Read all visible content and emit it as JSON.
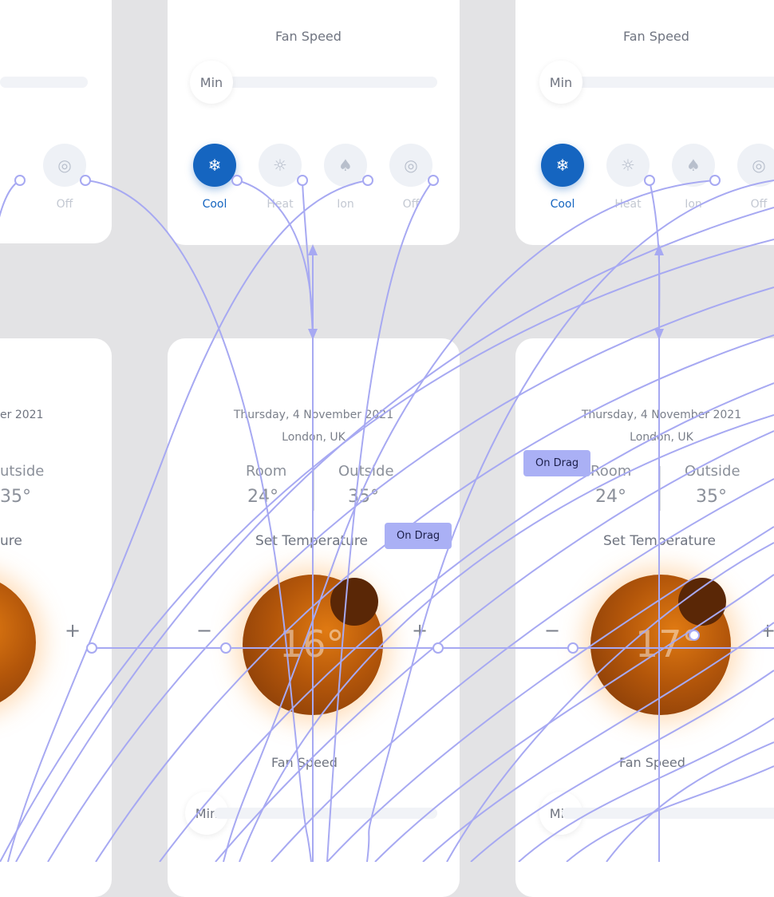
{
  "fan_speed_label": "Fan Speed",
  "min_label": "Min",
  "modes": [
    {
      "label": "Cool",
      "icon": "snowflake-icon",
      "glyph": "❄"
    },
    {
      "label": "Heat",
      "icon": "sun-icon",
      "glyph": "☼"
    },
    {
      "label": "Ion",
      "icon": "tree-icon",
      "glyph": "♠"
    },
    {
      "label": "Off",
      "icon": "power-icon",
      "glyph": "◎"
    }
  ],
  "partial_left": {
    "date": "er 2021",
    "outside": "utside",
    "outside_value": "35°",
    "set_temp": "ure"
  },
  "middle": {
    "date": "Thursday, 4 November 2021",
    "location": "London, UK",
    "room_label": "Room",
    "room_value": "24°",
    "outside_label": "Outside",
    "outside_value": "35°",
    "set_temp": "Set Temperature",
    "temp": "16°"
  },
  "right": {
    "date": "Thursday, 4 November 2021",
    "location": "London, UK",
    "room_label": "Room",
    "room_value": "24°",
    "outside_label": "Outside",
    "outside_value": "35°",
    "set_temp": "Set Temperature",
    "temp": "17°"
  },
  "stepper": {
    "plus": "+",
    "minus": "−"
  },
  "on_drag": "On Drag",
  "colors": {
    "accent": "#1565c0",
    "wire": "#a7a9f2",
    "dial": "#c9640c"
  }
}
